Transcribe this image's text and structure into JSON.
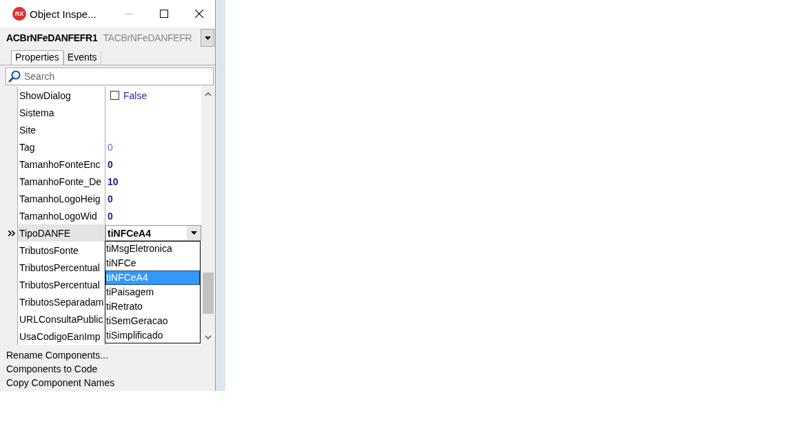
{
  "window": {
    "logo": "RX",
    "title": "Object Inspe..."
  },
  "component": {
    "name": "ACBrNFeDANFEFR1",
    "class": "TACBrNFeDANFEFR"
  },
  "tabs": [
    {
      "label": "Properties",
      "selected": true
    },
    {
      "label": "Events",
      "selected": false
    }
  ],
  "search": {
    "placeholder": "Search"
  },
  "properties": [
    {
      "name": "ShowDialog",
      "kind": "checkbox",
      "value": "False",
      "checked": false,
      "selected": false
    },
    {
      "name": "Sistema",
      "kind": "default",
      "selected": false
    },
    {
      "name": "Site",
      "kind": "default",
      "selected": false
    },
    {
      "name": "Tag",
      "kind": "default",
      "value": "0",
      "selected": false
    },
    {
      "name": "TamanhoFonteEnc",
      "kind": "changed",
      "value": "0",
      "selected": false
    },
    {
      "name": "TamanhoFonte_De",
      "kind": "changed",
      "value": "10",
      "selected": false
    },
    {
      "name": "TamanhoLogoHeig",
      "kind": "changed",
      "value": "0",
      "selected": false
    },
    {
      "name": "TamanhoLogoWid",
      "kind": "changed",
      "value": "0",
      "selected": false
    },
    {
      "name": "TipoDANFE",
      "kind": "combo",
      "value": "tiNFCeA4",
      "selected": true
    },
    {
      "name": "TributosFonte",
      "kind": "default",
      "selected": false
    },
    {
      "name": "TributosPercentual",
      "kind": "default",
      "selected": false
    },
    {
      "name": "TributosPercentual",
      "kind": "default",
      "selected": false
    },
    {
      "name": "TributosSeparadam",
      "kind": "default",
      "selected": false
    },
    {
      "name": "URLConsultaPublic",
      "kind": "default",
      "selected": false
    },
    {
      "name": "UsaCodigoEanImp",
      "kind": "default",
      "selected": false
    }
  ],
  "dropdown_options": [
    {
      "label": "tiMsgEletronica",
      "selected": false
    },
    {
      "label": "tiNFCe",
      "selected": false
    },
    {
      "label": "tiNFCeA4",
      "selected": true
    },
    {
      "label": "tiPaisagem",
      "selected": false
    },
    {
      "label": "tiRetrato",
      "selected": false
    },
    {
      "label": "tiSemGeracao",
      "selected": false
    },
    {
      "label": "tiSimplificado",
      "selected": false
    }
  ],
  "actions": [
    "Rename Components...",
    "Components to Code",
    "Copy Component Names"
  ]
}
